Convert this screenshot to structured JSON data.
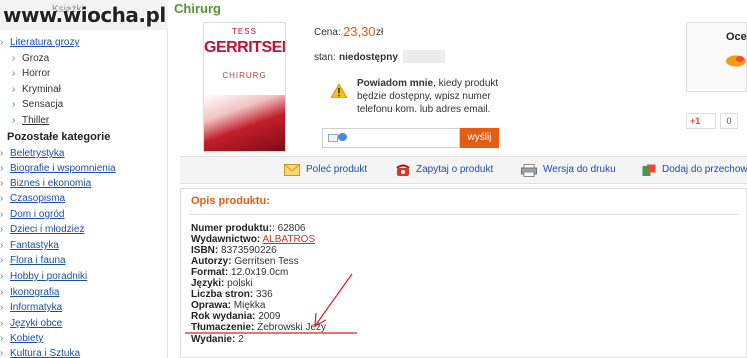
{
  "watermark": "www.wiocha.pl",
  "sidebar": {
    "header_label": "Książki",
    "items": [
      {
        "label": "Literatura grozy",
        "kind": "link",
        "level": 0
      },
      {
        "label": "Groza",
        "kind": "text",
        "level": 1
      },
      {
        "label": "Horror",
        "kind": "text",
        "level": 1
      },
      {
        "label": "Kryminał",
        "kind": "text",
        "level": 1
      },
      {
        "label": "Sensacja",
        "kind": "text",
        "level": 1
      },
      {
        "label": "Thiller",
        "kind": "text",
        "level": 1
      }
    ],
    "other_heading": "Pozostałe kategorie",
    "categories": [
      "Beletrystyka",
      "Biografie i wspomnienia",
      "Biznes i ekonomia",
      "Czasopisma",
      "Dom i ogród",
      "Dzieci i młodzież",
      "Fantastyka",
      "Flora i fauna",
      "Hobby i poradniki",
      "Ikonografia",
      "Informatyka",
      "Języki obce",
      "Kobiety",
      "Kultura i Sztuka"
    ]
  },
  "product": {
    "title": "Chirurg",
    "cover": {
      "top_text": "TESS",
      "author": "GERRITSEN",
      "title": "CHIRURG"
    },
    "price_label": "Cena:",
    "price_value": "23,30",
    "price_currency": "zł",
    "stock_label": "stan:",
    "stock_value": "niedostępny",
    "notify_bold": "Powiadom mnie",
    "notify_text": ", kiedy produkt będzie dostępny, wpisz numer telefonu kom. lub adres email.",
    "send_label": "wyślij",
    "rating_label": "Oce",
    "gplus_label": "+1",
    "gplus_count": "0"
  },
  "toolbar": {
    "items": [
      {
        "label": "Poleć produkt",
        "icon": "envelope-icon"
      },
      {
        "label": "Zapytaj o produkt",
        "icon": "phone-icon"
      },
      {
        "label": "Wersja do druku",
        "icon": "printer-icon"
      },
      {
        "label": "Dodaj do przechowalni",
        "icon": "storage-icon"
      }
    ]
  },
  "description": {
    "title": "Opis produktu:",
    "rows": [
      {
        "key": "Numer produktu:",
        "value": ": 62806"
      },
      {
        "key": "Wydawnictwo:",
        "value": "ALBATROS",
        "link": true
      },
      {
        "key": "ISBN:",
        "value": "8373590226"
      },
      {
        "key": "Autorzy:",
        "value": "Gerritsen Tess"
      },
      {
        "key": "Format:",
        "value": "12.0x19.0cm"
      },
      {
        "key": "Języki:",
        "value": "polski"
      },
      {
        "key": "Liczba stron:",
        "value": "336"
      },
      {
        "key": "Oprawa:",
        "value": "Miękka"
      },
      {
        "key": "Rok wydania:",
        "value": "2009"
      },
      {
        "key": "Tłumaczenie:",
        "value": "Żebrowski Jeży"
      },
      {
        "key": "Wydanie:",
        "value": "2"
      }
    ]
  },
  "colors": {
    "accent_green": "#55962f",
    "accent_orange": "#e05e14",
    "link_blue": "#1c4fa6",
    "annotation_red": "#d0202a"
  }
}
